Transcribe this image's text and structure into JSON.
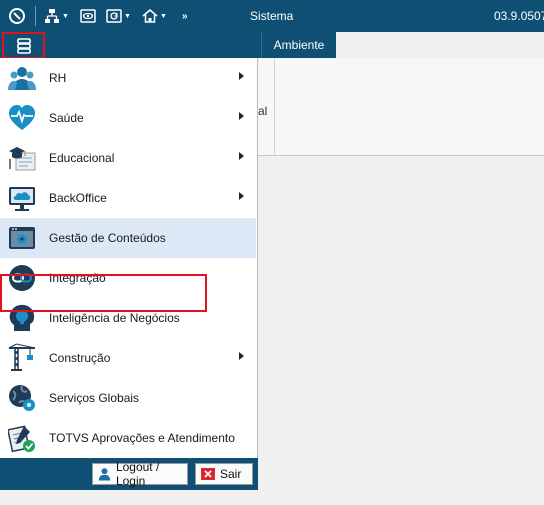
{
  "topbar": {
    "title": "Sistema",
    "version": "03.9.0507",
    "icons": [
      "logo-icon",
      "org-chart-icon",
      "eye-icon",
      "refresh-icon",
      "home-icon",
      "more-icon"
    ]
  },
  "tabs": {
    "ambiente": "Ambiente"
  },
  "ribbon": {
    "fragment": "al"
  },
  "menu": {
    "items": [
      {
        "label": "RH",
        "icon": "people-icon",
        "submenu": true
      },
      {
        "label": "Saúde",
        "icon": "heart-pulse-icon",
        "submenu": true
      },
      {
        "label": "Educacional",
        "icon": "graduation-icon",
        "submenu": true
      },
      {
        "label": "BackOffice",
        "icon": "monitor-cloud-icon",
        "submenu": true
      },
      {
        "label": "Gestão de Conteúdos",
        "icon": "gear-monitor-icon",
        "submenu": false,
        "selected": true
      },
      {
        "label": "Integração",
        "icon": "link-icon",
        "submenu": false
      },
      {
        "label": "Inteligência de Negócios",
        "icon": "bulb-head-icon",
        "submenu": false
      },
      {
        "label": "Construção",
        "icon": "crane-icon",
        "submenu": true
      },
      {
        "label": "Serviços Globais",
        "icon": "globe-gear-icon",
        "submenu": false
      },
      {
        "label": "TOTVS Aprovações e Atendimento",
        "icon": "approval-icon",
        "submenu": false
      }
    ]
  },
  "footer": {
    "login_label": "Logout / Login",
    "exit_label": "Sair"
  },
  "colors": {
    "primary": "#0e4f73",
    "highlight": "#e0141e",
    "selected_bg": "#dde8f7"
  }
}
